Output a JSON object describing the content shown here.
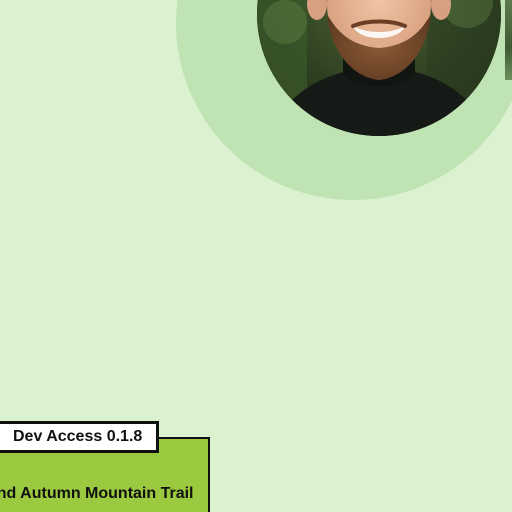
{
  "badge": {
    "label": "Dev Access 0.1.8"
  },
  "trail_card": {
    "title": "ond Autumn Mountain Trail"
  },
  "profile": {
    "avatar_icon": "profile-photo-icon"
  },
  "colors": {
    "background": "#dbf2d1",
    "ring": "#c0e3b3",
    "card": "#9bc93f",
    "border": "#111111"
  }
}
